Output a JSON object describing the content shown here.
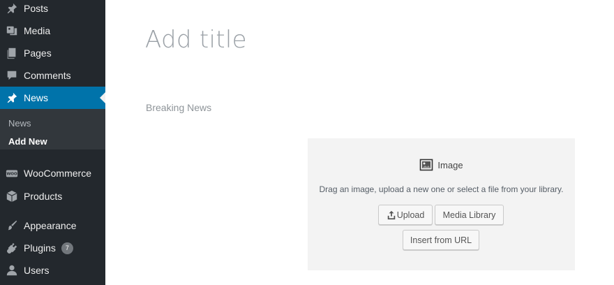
{
  "sidebar": {
    "items": [
      {
        "label": "Posts",
        "icon": "pushpin-icon"
      },
      {
        "label": "Media",
        "icon": "media-icon"
      },
      {
        "label": "Pages",
        "icon": "pages-icon"
      },
      {
        "label": "Comments",
        "icon": "comment-icon"
      },
      {
        "label": "News",
        "icon": "pushpin-icon",
        "active": true
      },
      {
        "label": "WooCommerce",
        "icon": "woocommerce-icon"
      },
      {
        "label": "Products",
        "icon": "box-icon"
      },
      {
        "label": "Appearance",
        "icon": "paintbrush-icon"
      },
      {
        "label": "Plugins",
        "icon": "plugin-icon",
        "badge": "7"
      },
      {
        "label": "Users",
        "icon": "user-icon"
      }
    ],
    "submenu": [
      {
        "label": "News"
      },
      {
        "label": "Add New",
        "current": true
      }
    ],
    "colors": {
      "background": "#23282d",
      "active": "#0073aa",
      "submenu_bg": "#32373c"
    }
  },
  "editor": {
    "title_placeholder": "Add title",
    "subtitle": "Breaking News",
    "image_block": {
      "label": "Image",
      "icon": "image-icon",
      "instructions": "Drag an image, upload a new one or select a file from your library.",
      "upload_label": "Upload",
      "media_library_label": "Media Library",
      "insert_url_label": "Insert from URL"
    }
  }
}
